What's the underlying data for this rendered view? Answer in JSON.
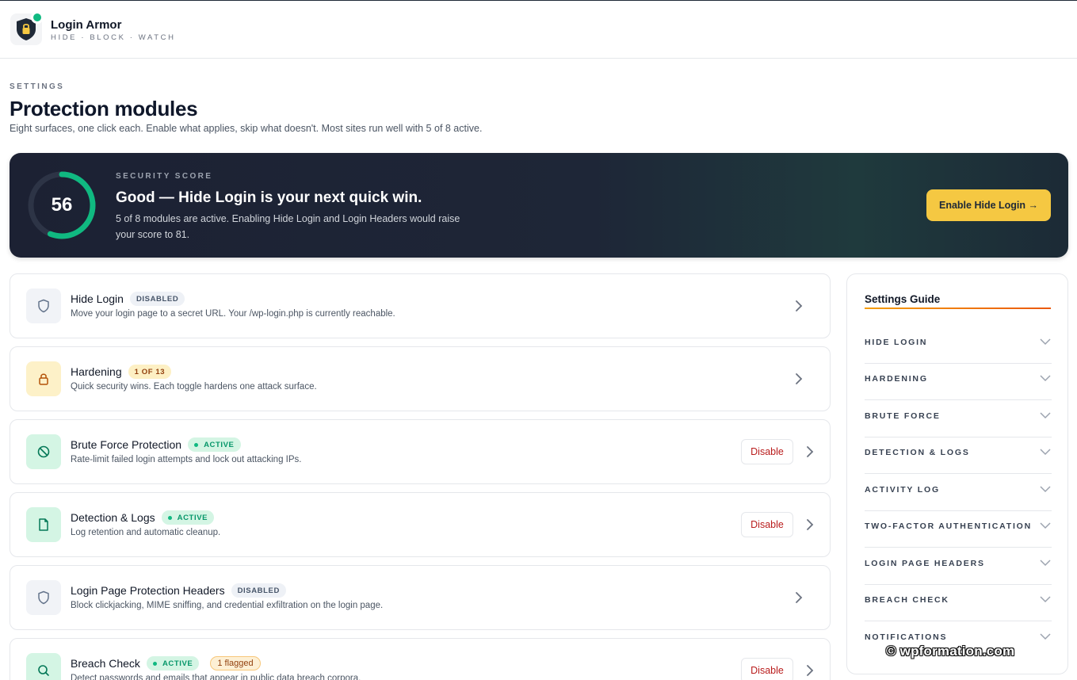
{
  "app": {
    "title": "Login Armor",
    "tagline": "HIDE · BLOCK · WATCH",
    "status_color": "#10b981"
  },
  "page": {
    "eyebrow": "SETTINGS",
    "title": "Protection modules",
    "subtitle": "Eight surfaces, one click each. Enable what applies, skip what doesn't. Most sites run well with 5 of 8 active."
  },
  "score": {
    "eyebrow": "SECURITY SCORE",
    "value": "56",
    "value_fraction": 0.56,
    "headline": "Good — Hide Login is your next quick win.",
    "description": "5 of 8 modules are active. Enabling Hide Login and Login Headers would raise your score to 81.",
    "cta_label": "Enable Hide Login →",
    "ring_color": "#10b981",
    "cta_color": "#f5c842"
  },
  "modules": [
    {
      "name": "Hide Login",
      "badge": "DISABLED",
      "description": "Move your login page to a secret URL. Your /wp-login.php is currently reachable.",
      "icon": "shield-icon"
    },
    {
      "name": "Hardening",
      "badge": "1 OF 13",
      "description": "Quick security wins. Each toggle hardens one attack surface.",
      "icon": "lock-icon"
    },
    {
      "name": "Brute Force Protection",
      "badge": "ACTIVE",
      "description": "Rate-limit failed login attempts and lock out attacking IPs.",
      "action": "Disable",
      "icon": "block-icon"
    },
    {
      "name": "Detection & Logs",
      "badge": "ACTIVE",
      "description": "Log retention and automatic cleanup.",
      "action": "Disable",
      "icon": "document-icon"
    },
    {
      "name": "Login Page Protection Headers",
      "badge": "DISABLED",
      "description": "Block clickjacking, MIME sniffing, and credential exfiltration on the login page.",
      "icon": "shield-icon"
    },
    {
      "name": "Breach Check",
      "badge": "ACTIVE",
      "extra_badge": "1 flagged",
      "description": "Detect passwords and emails that appear in public data breach corpora.",
      "action": "Disable",
      "icon": "search-icon"
    }
  ],
  "guide": {
    "title": "Settings Guide",
    "items": [
      "HIDE LOGIN",
      "HARDENING",
      "BRUTE FORCE",
      "DETECTION & LOGS",
      "ACTIVITY LOG",
      "TWO-FACTOR AUTHENTICATION",
      "LOGIN PAGE HEADERS",
      "BREACH CHECK",
      "NOTIFICATIONS"
    ]
  },
  "watermark": "© wpformation.com"
}
